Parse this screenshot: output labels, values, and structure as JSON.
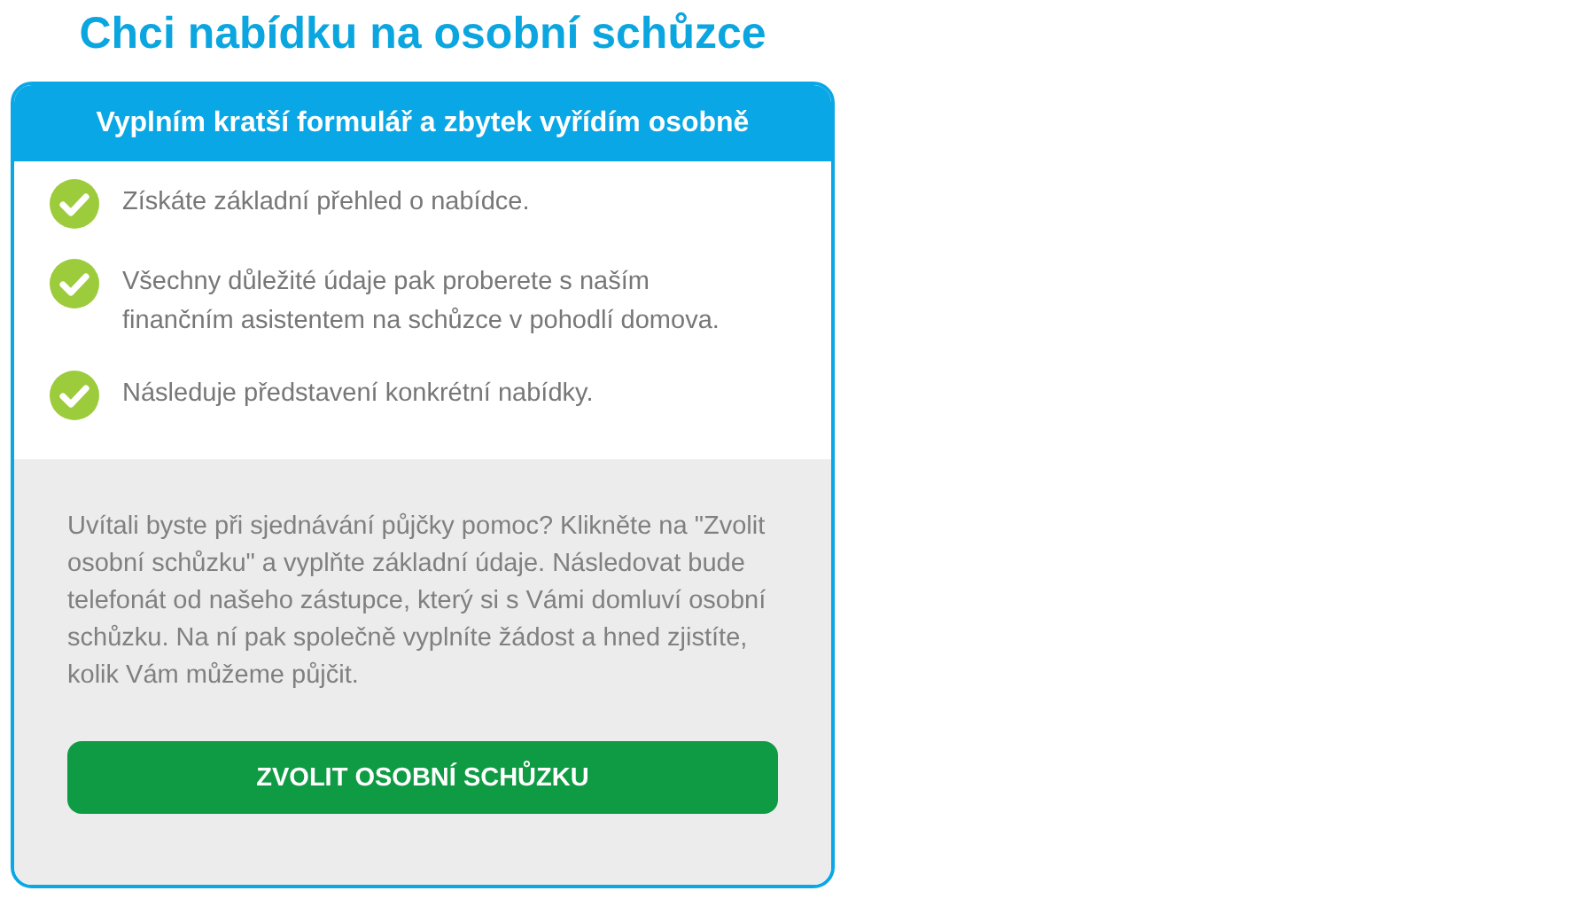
{
  "title": "Chci nabídku na osobní schůzce",
  "card": {
    "header": "Vyplním kratší formulář a zbytek vyřídím osobně",
    "benefits": [
      {
        "text": "Získáte základní přehled o nabídce.",
        "checked": true
      },
      {
        "text": "Všechny důležité údaje pak proberete s naším finančním asistentem na schůzce v pohodlí domova.",
        "checked": true
      },
      {
        "text": "Následuje představení konkrétní nabídky.",
        "checked": true
      }
    ],
    "description": "Uvítali byste při sjednávání půjčky pomoc? Klikněte na \"Zvolit osobní schůzku\" a vyplňte základní údaje. Následovat bude telefonát od našeho zástupce, který si s Vámi domluví osobní schůzku. Na ní pak společně vyplníte žádost a hned zjistíte, kolik Vám můžeme půjčit.",
    "button": "ZVOLIT OSOBNÍ SCHŮZKU"
  }
}
